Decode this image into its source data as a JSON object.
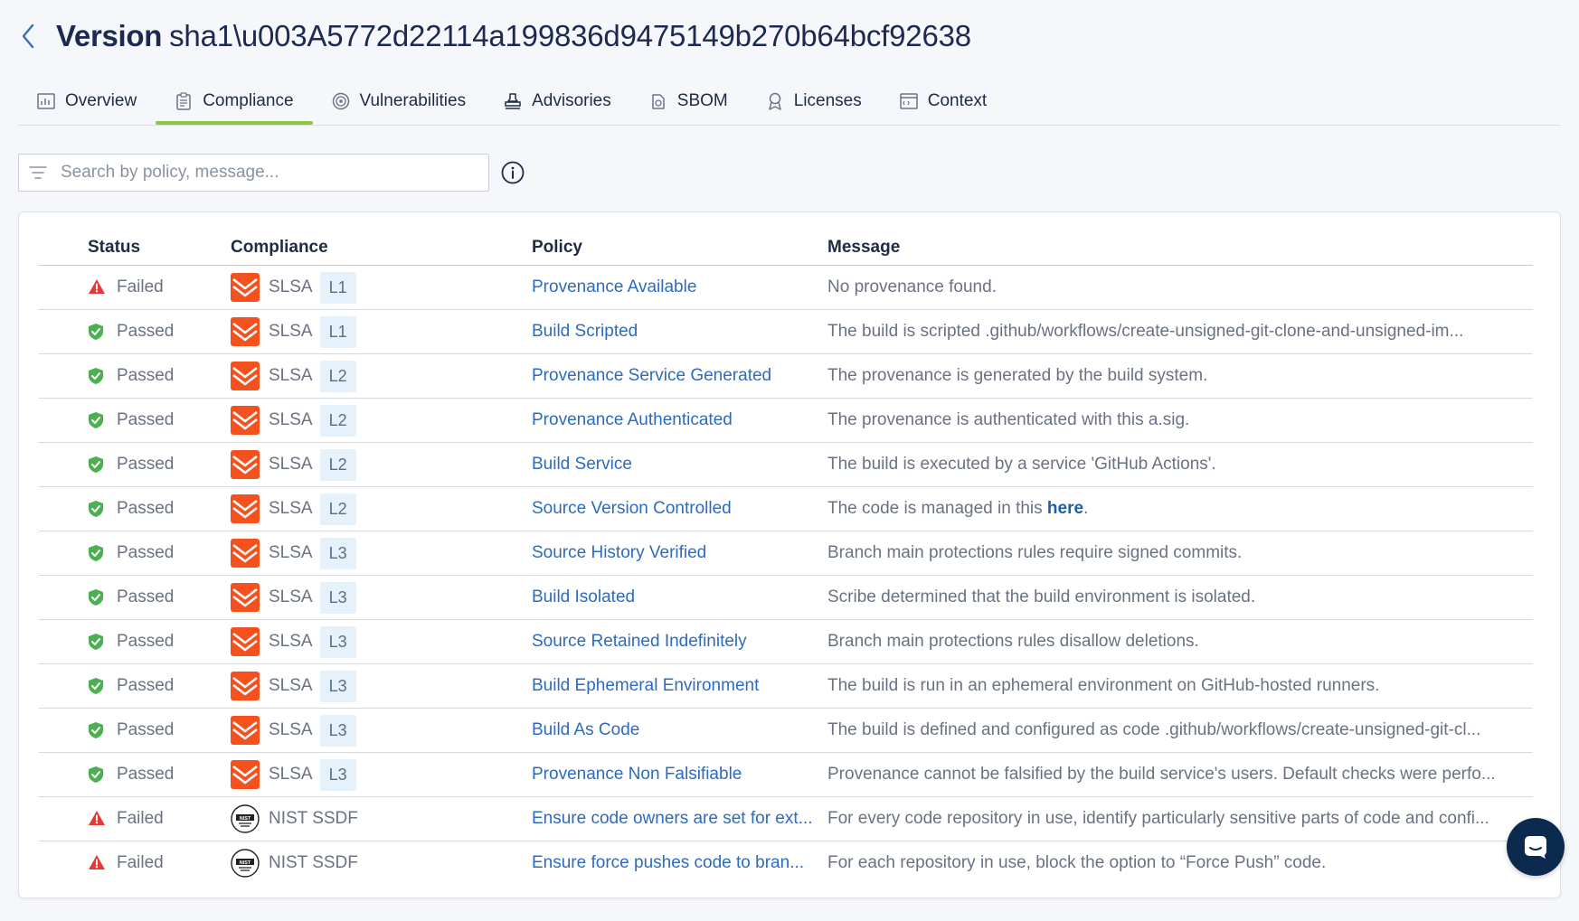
{
  "header": {
    "title_label": "Version",
    "version_id": "sha1\\u003A5772d22114a199836d9475149b270b64bcf92638"
  },
  "tabs": [
    {
      "label": "Overview",
      "icon": "chart-icon",
      "active": false
    },
    {
      "label": "Compliance",
      "icon": "clipboard-icon",
      "active": true
    },
    {
      "label": "Vulnerabilities",
      "icon": "target-icon",
      "active": false
    },
    {
      "label": "Advisories",
      "icon": "stamp-icon",
      "active": false
    },
    {
      "label": "SBOM",
      "icon": "package-icon",
      "active": false
    },
    {
      "label": "Licenses",
      "icon": "badge-icon",
      "active": false
    },
    {
      "label": "Context",
      "icon": "window-icon",
      "active": false
    }
  ],
  "search": {
    "placeholder": "Search by policy, message...",
    "value": ""
  },
  "table": {
    "columns": {
      "status": "Status",
      "compliance": "Compliance",
      "policy": "Policy",
      "message": "Message"
    },
    "rows": [
      {
        "status": "Failed",
        "framework": "SLSA",
        "level": "L1",
        "policy": "Provenance Available",
        "message": "No provenance found."
      },
      {
        "status": "Passed",
        "framework": "SLSA",
        "level": "L1",
        "policy": "Build Scripted",
        "message": "The build is scripted .github/workflows/create-unsigned-git-clone-and-unsigned-im..."
      },
      {
        "status": "Passed",
        "framework": "SLSA",
        "level": "L2",
        "policy": "Provenance Service Generated",
        "message": "The provenance is generated by the build system."
      },
      {
        "status": "Passed",
        "framework": "SLSA",
        "level": "L2",
        "policy": "Provenance Authenticated",
        "message": "The provenance is authenticated with this a.sig."
      },
      {
        "status": "Passed",
        "framework": "SLSA",
        "level": "L2",
        "policy": "Build Service",
        "message": "The build is executed by a service 'GitHub Actions'."
      },
      {
        "status": "Passed",
        "framework": "SLSA",
        "level": "L2",
        "policy": "Source Version Controlled",
        "message": "The code is managed in this ",
        "link": "here",
        "message_tail": "."
      },
      {
        "status": "Passed",
        "framework": "SLSA",
        "level": "L3",
        "policy": "Source History Verified",
        "message": "Branch main protections rules require signed commits."
      },
      {
        "status": "Passed",
        "framework": "SLSA",
        "level": "L3",
        "policy": "Build Isolated",
        "message": "Scribe determined that the build environment is isolated."
      },
      {
        "status": "Passed",
        "framework": "SLSA",
        "level": "L3",
        "policy": "Source Retained Indefinitely",
        "message": "Branch main protections rules disallow deletions."
      },
      {
        "status": "Passed",
        "framework": "SLSA",
        "level": "L3",
        "policy": "Build Ephemeral Environment",
        "message": "The build is run in an ephemeral environment on GitHub-hosted runners."
      },
      {
        "status": "Passed",
        "framework": "SLSA",
        "level": "L3",
        "policy": "Build As Code",
        "message": "The build is defined and configured as code .github/workflows/create-unsigned-git-cl..."
      },
      {
        "status": "Passed",
        "framework": "SLSA",
        "level": "L3",
        "policy": "Provenance Non Falsifiable",
        "message": "Provenance cannot be falsified by the build service's users. Default checks were perfo..."
      },
      {
        "status": "Failed",
        "framework": "NIST SSDF",
        "level": "",
        "policy": "Ensure code owners are set for ext...",
        "message": "For every code repository in use, identify particularly sensitive parts of code and confi..."
      },
      {
        "status": "Failed",
        "framework": "NIST SSDF",
        "level": "",
        "policy": "Ensure force pushes code to bran...",
        "message": "For each repository in use, block the option to “Force Push” code."
      }
    ]
  },
  "colors": {
    "accent_tab": "#8dc63f",
    "failed": "#e53935",
    "passed": "#4caf50",
    "link": "#2d6bbf",
    "slsa_logo": "#f4511e",
    "chat_button": "#0b2a4e"
  },
  "icons": {
    "back": "chevron-left-icon",
    "filter": "filter-icon",
    "info": "info-icon",
    "chat": "chat-icon"
  }
}
